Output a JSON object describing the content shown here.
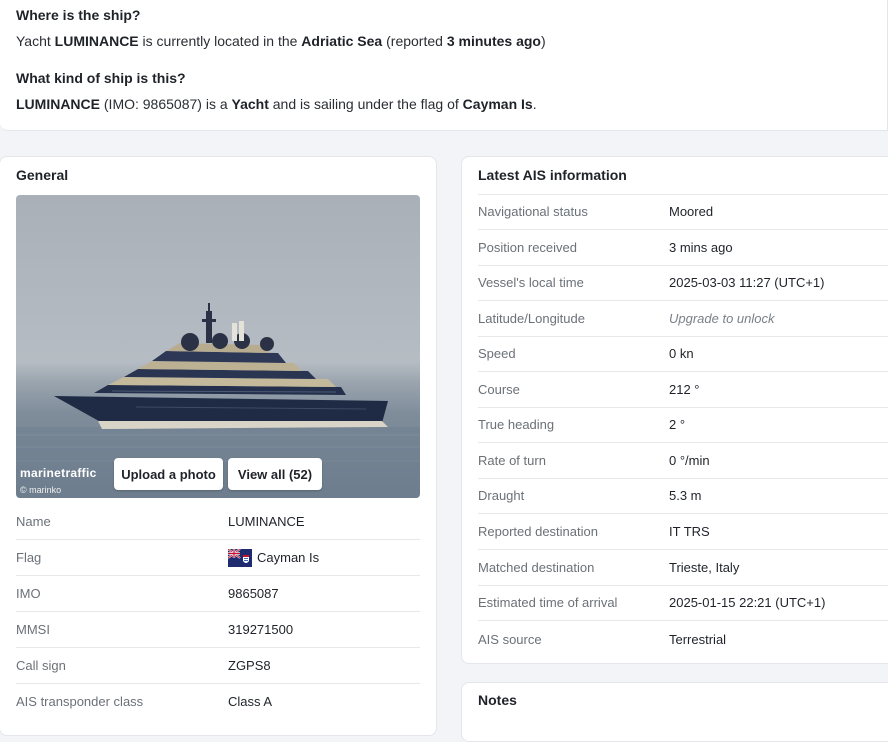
{
  "summary": {
    "q1": "Where is the ship?",
    "a1_pre": "Yacht ",
    "a1_name": "LUMINANCE",
    "a1_mid": " is currently located in the ",
    "a1_sea": "Adriatic Sea",
    "a1_rep": " (reported ",
    "a1_time": "3 minutes ago",
    "a1_end": ")",
    "q2": "What kind of ship is this?",
    "a2_name": "LUMINANCE",
    "a2_imo": " (IMO: 9865087) is a ",
    "a2_type": "Yacht",
    "a2_mid": " and is sailing under the flag of ",
    "a2_flag": "Cayman Is",
    "a2_end": "."
  },
  "general": {
    "title": "General",
    "photo_brand": "marinetraffic",
    "photo_credit": "© marinko",
    "upload_label": "Upload a photo",
    "view_all_label": "View all (52)",
    "rows": [
      {
        "label": "Name",
        "value": "LUMINANCE"
      },
      {
        "label": "Flag",
        "value": "Cayman Is"
      },
      {
        "label": "IMO",
        "value": "9865087"
      },
      {
        "label": "MMSI",
        "value": "319271500"
      },
      {
        "label": "Call sign",
        "value": "ZGPS8"
      },
      {
        "label": "AIS transponder class",
        "value": "Class A"
      }
    ]
  },
  "ais": {
    "title": "Latest AIS information",
    "rows": [
      {
        "label": "Navigational status",
        "value": "Moored"
      },
      {
        "label": "Position received",
        "value": "3 mins ago"
      },
      {
        "label": "Vessel's local time",
        "value": "2025-03-03 11:27 (UTC+1)"
      },
      {
        "label": "Latitude/Longitude",
        "value": "Upgrade to unlock"
      },
      {
        "label": "Speed",
        "value": "0 kn"
      },
      {
        "label": "Course",
        "value": "212 °"
      },
      {
        "label": "True heading",
        "value": "2 °"
      },
      {
        "label": "Rate of turn",
        "value": "0 °/min"
      },
      {
        "label": "Draught",
        "value": "5.3 m"
      },
      {
        "label": "Reported destination",
        "value": "IT TRS"
      },
      {
        "label": "Matched destination",
        "value": "Trieste, Italy"
      },
      {
        "label": "Estimated time of arrival",
        "value": "2025-01-15 22:21 (UTC+1)"
      },
      {
        "label": "AIS source",
        "value": "Terrestrial"
      }
    ]
  },
  "notes": {
    "title": "Notes"
  },
  "icons": {
    "flag": "cayman-islands-flag-icon"
  }
}
